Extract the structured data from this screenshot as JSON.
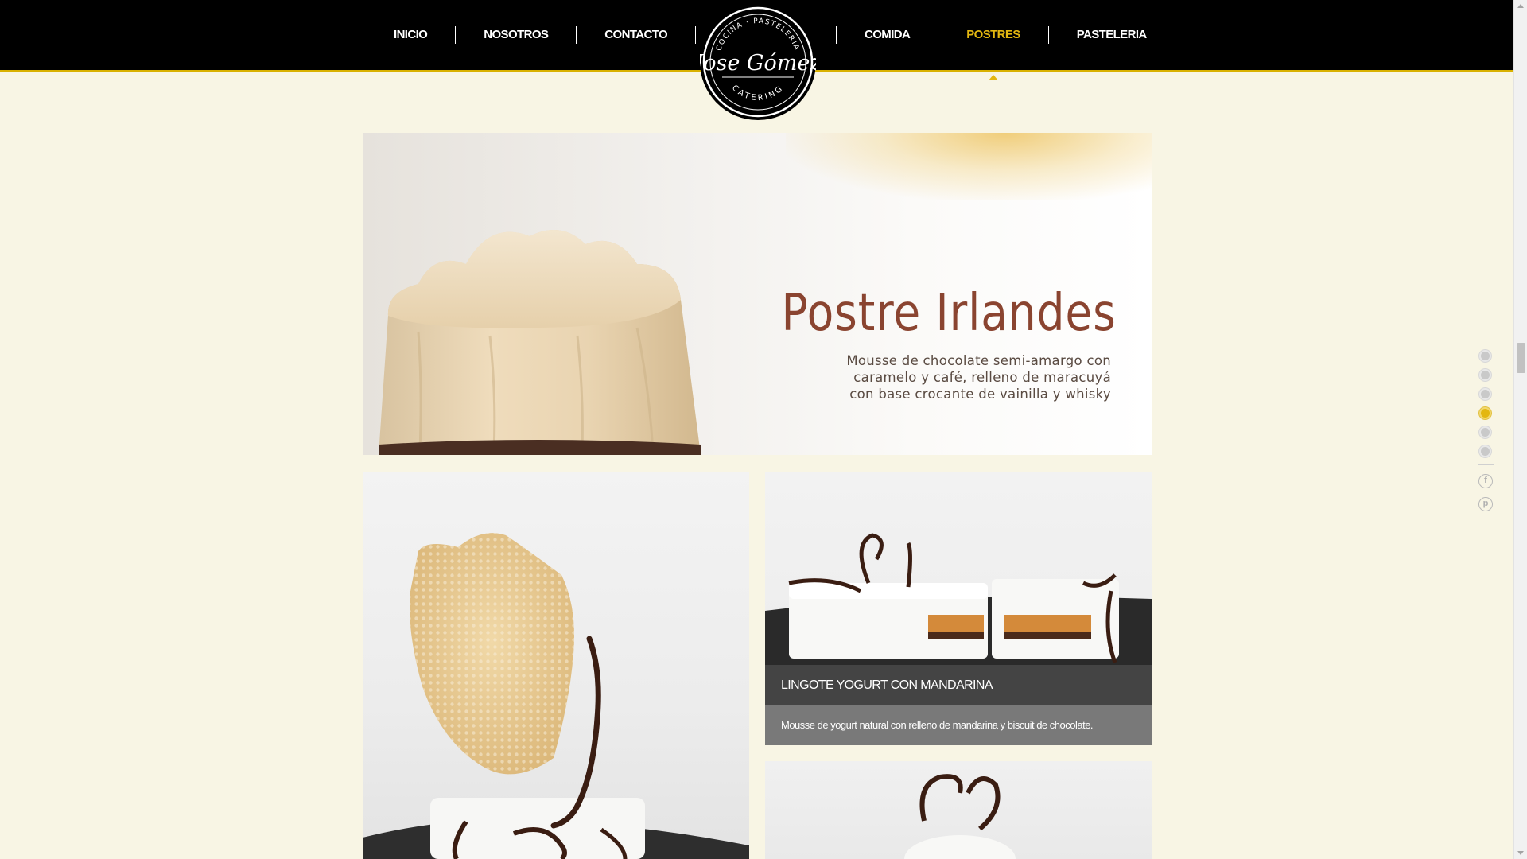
{
  "nav": {
    "left": [
      "INICIO",
      "NOSOTROS",
      "CONTACTO"
    ],
    "right": [
      "COMIDA",
      "POSTRES",
      "PASTELERIA"
    ],
    "active": "POSTRES"
  },
  "logo": {
    "arc_top": "COCINA · PASTELERIA",
    "name": "Jose Gómez",
    "arc_bottom": "CATERING"
  },
  "banner": {
    "title": "Postre Irlandes",
    "description": [
      "Mousse de chocolate semi-amargo con",
      "caramelo y café, relleno de maracuyá",
      "con base crocante de vainilla y whisky"
    ]
  },
  "cards": {
    "right_top": {
      "title": "LINGOTE YOGURT CON MANDARINA",
      "description": "Mousse de yogurt natural con relleno de mandarina y biscuit de chocolate."
    }
  },
  "side_nav": {
    "dots": 6,
    "active_index": 3,
    "social": [
      "facebook-icon",
      "pinterest-icon"
    ]
  },
  "colors": {
    "accent": "#e3b710",
    "topbar": "#000000",
    "page_bg": "#f8f5e4",
    "banner_title": "#8a4430"
  }
}
